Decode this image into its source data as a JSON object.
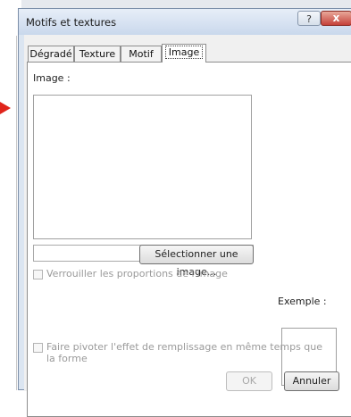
{
  "dialog": {
    "title": "Motifs et textures",
    "help_label": "?",
    "close_label": "x"
  },
  "tabs": [
    {
      "label": "Dégradé"
    },
    {
      "label": "Texture"
    },
    {
      "label": "Motif"
    },
    {
      "label": "Image",
      "active": true
    }
  ],
  "image_panel": {
    "image_label": "Image :",
    "filename_value": "",
    "select_button": "Sélectionner une image...",
    "lock_ratio_label": "Verrouiller les proportions de l'image",
    "lock_ratio_checked": false,
    "rotate_label_line1": "Faire pivoter l'effet de remplissage en même temps que",
    "rotate_label_line2": "la forme",
    "rotate_checked": false,
    "example_label": "Exemple :"
  },
  "footer": {
    "ok_label": "OK",
    "cancel_label": "Annuler"
  }
}
